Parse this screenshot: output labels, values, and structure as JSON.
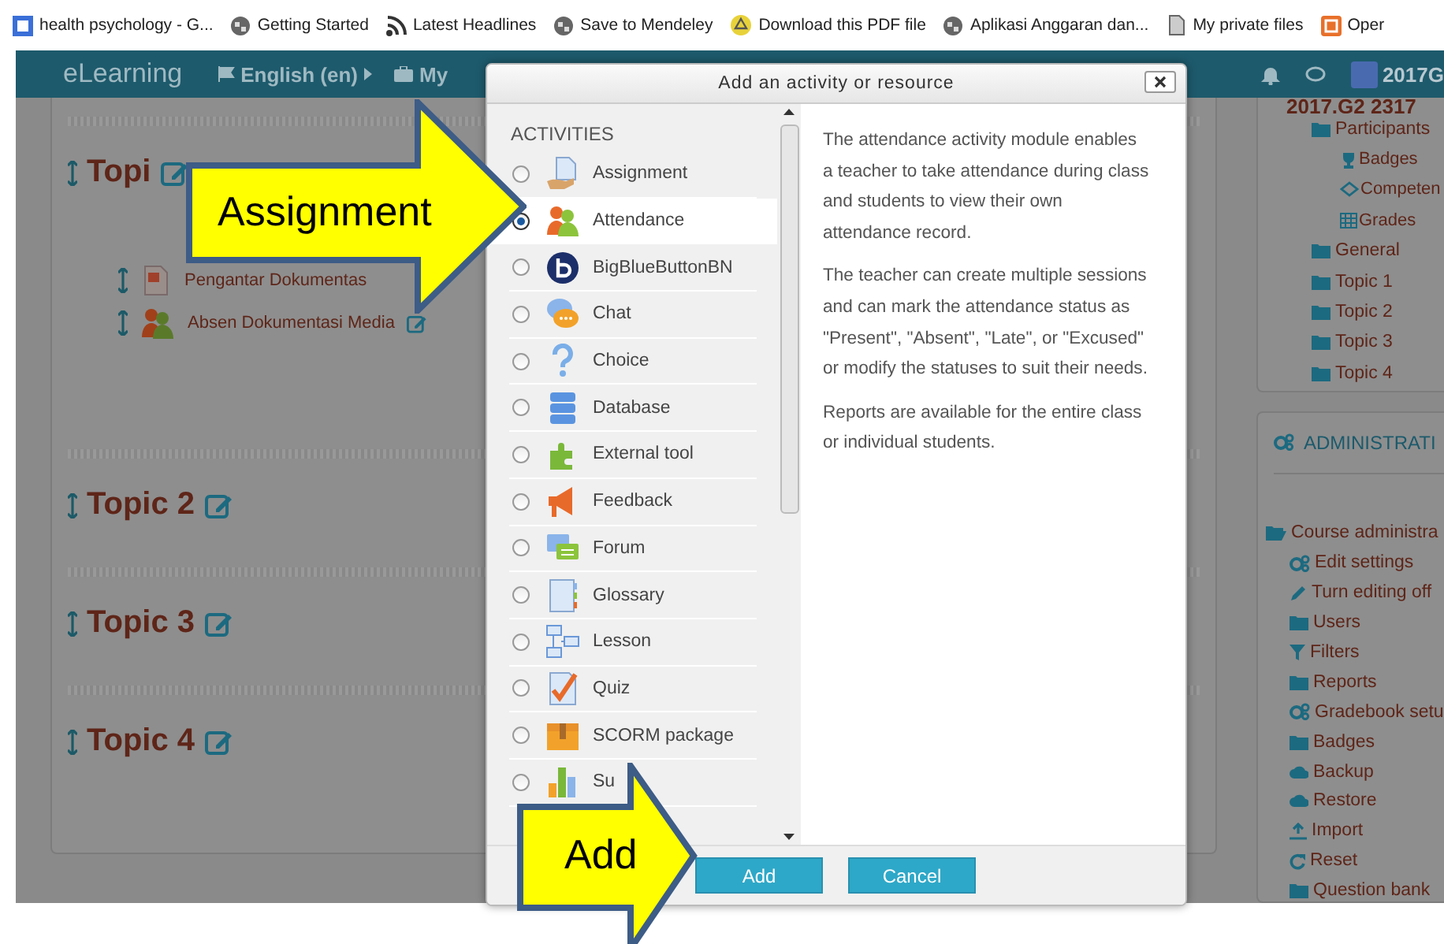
{
  "bookmarks": [
    {
      "label": "health psychology - G..."
    },
    {
      "label": "Getting Started"
    },
    {
      "label": "Latest Headlines"
    },
    {
      "label": "Save to Mendeley"
    },
    {
      "label": "Download this PDF file"
    },
    {
      "label": "Aplikasi Anggaran dan..."
    },
    {
      "label": "My private files"
    },
    {
      "label": "Oper"
    }
  ],
  "navbar": {
    "brand": "eLearning",
    "language": "English (en)",
    "my_menu": "My",
    "user": "2017G"
  },
  "topics": [
    {
      "title": "Topi",
      "activities": [
        {
          "label": "Pengantar Dokumentas"
        },
        {
          "label": "Absen Dokumentasi Media"
        }
      ]
    },
    {
      "title": "Topic 2"
    },
    {
      "title": "Topic 3"
    },
    {
      "title": "Topic 4"
    }
  ],
  "navigation_block": {
    "course": "2017.G2 2317",
    "items": [
      {
        "label": "Participants",
        "children": [
          {
            "label": "Badges"
          },
          {
            "label": "Competen"
          },
          {
            "label": "Grades"
          }
        ]
      },
      {
        "label": "General"
      },
      {
        "label": "Topic 1"
      },
      {
        "label": "Topic 2"
      },
      {
        "label": "Topic 3"
      },
      {
        "label": "Topic 4"
      }
    ]
  },
  "administration_block": {
    "title": "ADMINISTRATI",
    "items": [
      {
        "label": "Course administra",
        "children": [
          {
            "label": "Edit settings"
          },
          {
            "label": "Turn editing off"
          },
          {
            "label": "Users"
          },
          {
            "label": "Filters"
          },
          {
            "label": "Reports"
          },
          {
            "label": "Gradebook setu"
          },
          {
            "label": "Badges"
          },
          {
            "label": "Backup"
          },
          {
            "label": "Restore"
          },
          {
            "label": "Import"
          },
          {
            "label": "Reset"
          },
          {
            "label": "Question bank"
          }
        ]
      }
    ]
  },
  "dialog": {
    "title": "Add an activity or resource",
    "section": "ACTIVITIES",
    "activities": [
      {
        "label": "Assignment",
        "selected": false
      },
      {
        "label": "Attendance",
        "selected": true
      },
      {
        "label": "BigBlueButtonBN",
        "selected": false
      },
      {
        "label": "Chat",
        "selected": false
      },
      {
        "label": "Choice",
        "selected": false
      },
      {
        "label": "Database",
        "selected": false
      },
      {
        "label": "External tool",
        "selected": false
      },
      {
        "label": "Feedback",
        "selected": false
      },
      {
        "label": "Forum",
        "selected": false
      },
      {
        "label": "Glossary",
        "selected": false
      },
      {
        "label": "Lesson",
        "selected": false
      },
      {
        "label": "Quiz",
        "selected": false
      },
      {
        "label": "SCORM package",
        "selected": false
      },
      {
        "label": "Su",
        "selected": false
      }
    ],
    "description": [
      "The attendance activity module enables a teacher to take attendance during class and students to view their own attendance record.",
      "The teacher can create multiple sessions and can mark the attendance status as \"Present\", \"Absent\", \"Late\", or \"Excused\" or modify the statuses to suit their needs.",
      "Reports are available for the entire class or individual students."
    ],
    "buttons": [
      {
        "label": "Add"
      },
      {
        "label": "Cancel"
      }
    ]
  },
  "callouts": [
    {
      "label": "Assignment",
      "kind": "large"
    },
    {
      "label": "Add",
      "kind": "small"
    }
  ]
}
